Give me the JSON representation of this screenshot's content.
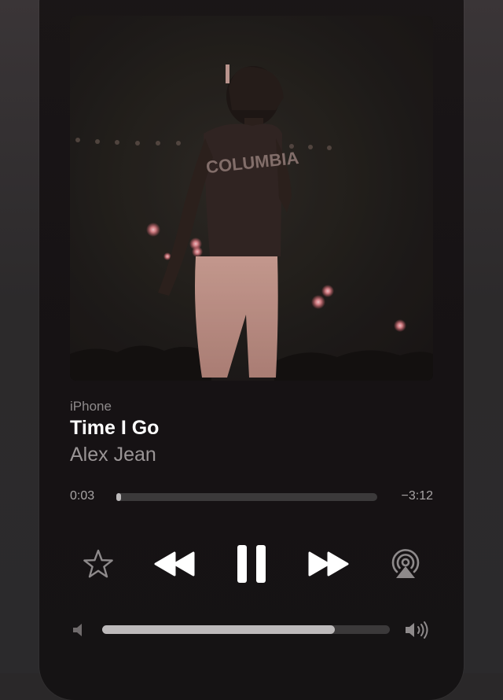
{
  "now_playing": {
    "source": "iPhone",
    "title": "Time I Go",
    "artist": "Alex Jean"
  },
  "playback": {
    "elapsed": "0:03",
    "remaining": "−3:12",
    "progress_fraction": 0.016
  },
  "volume": {
    "level_fraction": 0.81
  },
  "artwork": {
    "shirt_text": "COLUMBIA"
  },
  "icons": {
    "favorite": "star-icon",
    "rewind": "rewind-icon",
    "pause": "pause-icon",
    "fast_forward": "fast-forward-icon",
    "airplay": "airplay-audio-icon",
    "volume_low": "speaker-low-icon",
    "volume_high": "speaker-high-icon"
  },
  "colors": {
    "background": "#2a2829",
    "card": "#161214",
    "primary_text": "#ffffff",
    "secondary_text": "#9a9596",
    "track": "#3b393a",
    "track_fill": "#bdbabb",
    "control_icon": "#ffffff",
    "muted_icon": "#8e8a8b"
  }
}
